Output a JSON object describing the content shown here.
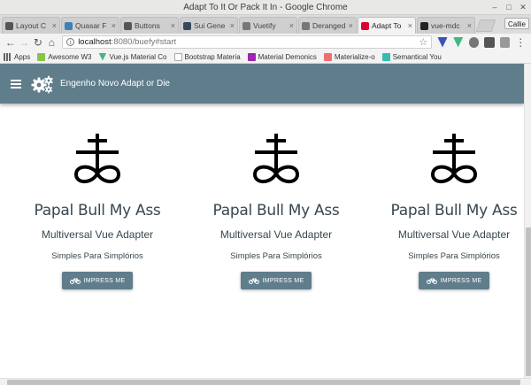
{
  "window": {
    "title": "Adapt To It Or Pack It In - Google Chrome"
  },
  "tabs": [
    {
      "label": "Layout C",
      "color": "#555555"
    },
    {
      "label": "Quasar F",
      "color": "#3f80b5"
    },
    {
      "label": "Buttons",
      "color": "#555555"
    },
    {
      "label": "Sui Gene",
      "color": "#35495e"
    },
    {
      "label": "Vuetify",
      "color": "#777777"
    },
    {
      "label": "Deranged",
      "color": "#777777"
    },
    {
      "label": "Adapt To",
      "color": "#dd0031",
      "active": true
    },
    {
      "label": "vue-mdc",
      "color": "#222222"
    }
  ],
  "profile_label": "Callie",
  "address": {
    "host": "localhost",
    "path": ":8080/buefy#start"
  },
  "bookmarks": [
    {
      "label": "Apps",
      "color": "#666666"
    },
    {
      "label": "Awesome W3",
      "color": "#8bc34a"
    },
    {
      "label": "Vue.js Material Co",
      "color": "#42b883"
    },
    {
      "label": "Bootstrap Materia",
      "color": "#ffffff"
    },
    {
      "label": "Material Demonics",
      "color": "#9c27b0"
    },
    {
      "label": "Materialize-o",
      "color": "#ee6e73"
    },
    {
      "label": "Semantical You",
      "color": "#35bdb2"
    }
  ],
  "app_bar": {
    "title": "Engenho Novo Adapt or Die",
    "color": "#607d8b"
  },
  "cards": [
    {
      "title": "Papal Bull My Ass",
      "subtitle": "Multiversal Vue Adapter",
      "text": "Simples Para Simplórios",
      "button": "IMPRESS ME"
    },
    {
      "title": "Papal Bull My Ass",
      "subtitle": "Multiversal Vue Adapter",
      "text": "Simples Para Simplórios",
      "button": "IMPRESS ME"
    },
    {
      "title": "Papal Bull My Ass",
      "subtitle": "Multiversal Vue Adapter",
      "text": "Simples Para Simplórios",
      "button": "IMPRESS ME"
    }
  ]
}
